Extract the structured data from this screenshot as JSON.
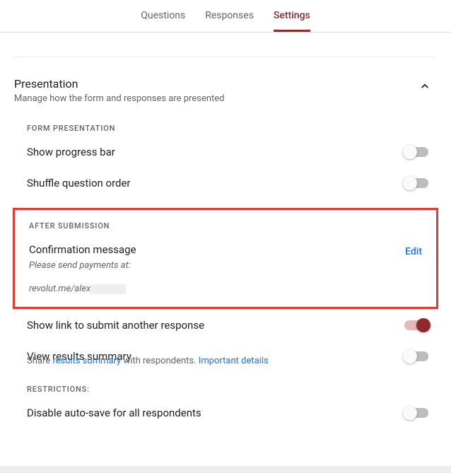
{
  "tabs": {
    "questions": "Questions",
    "responses": "Responses",
    "settings": "Settings"
  },
  "presentation": {
    "title": "Presentation",
    "subtitle": "Manage how the form and responses are presented"
  },
  "form_presentation": {
    "label": "FORM PRESENTATION",
    "progress_bar": "Show progress bar",
    "shuffle": "Shuffle question order"
  },
  "after_submission": {
    "label": "AFTER SUBMISSION",
    "confirmation_title": "Confirmation message",
    "confirmation_line1": "Please send payments at:",
    "confirmation_line2_prefix": "revolut.me/alex",
    "edit": "Edit",
    "another_response": "Show link to submit another response",
    "results_title": "View results summary",
    "results_share_prefix": "Share ",
    "results_share_link": "results summary",
    "results_share_suffix": " with respondents. ",
    "results_details_link": "Important details"
  },
  "restrictions": {
    "label": "RESTRICTIONS:",
    "autosave": "Disable auto-save for all respondents"
  }
}
